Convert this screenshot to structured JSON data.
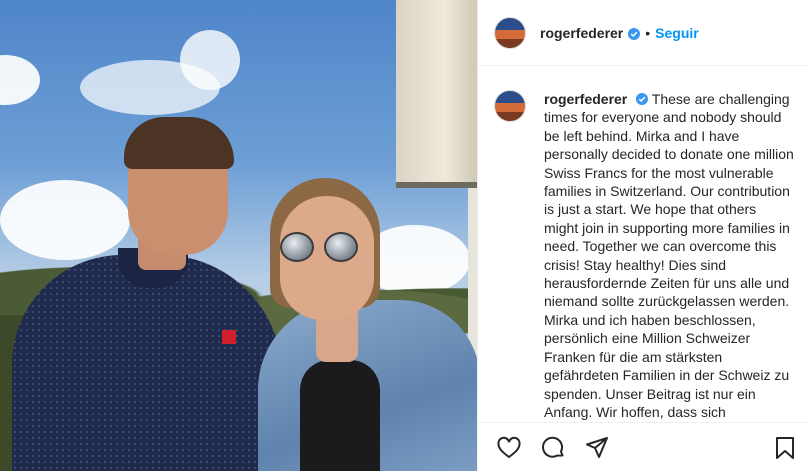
{
  "post": {
    "username": "rogerfederer",
    "separator": "•",
    "follow_label": "Seguir",
    "caption": "These are challenging times for everyone and nobody should be left behind. Mirka and I have personally decided to donate one million Swiss Francs for the most vulnerable families in Switzerland. Our contribution is just a start. We hope that others might join in supporting more families in need. Together we can overcome this crisis! Stay healthy! Dies sind herausfordernde Zeiten für uns alle und niemand sollte zurückgelassen werden. Mirka und ich haben beschlossen, persönlich eine Million Schweizer Franken für die am stärksten gefährdeten Familien in der Schweiz zu spenden. Unser Beitrag ist nur ein Anfang. Wir hoffen, dass sich",
    "shirt_logo": "UNI QLO"
  },
  "icons": {
    "verified": "verified-badge-icon",
    "like": "heart-icon",
    "comment": "comment-icon",
    "share": "paper-plane-icon",
    "save": "bookmark-icon"
  },
  "colors": {
    "accent": "#0095f6",
    "text": "#262626",
    "border": "#efefef"
  }
}
